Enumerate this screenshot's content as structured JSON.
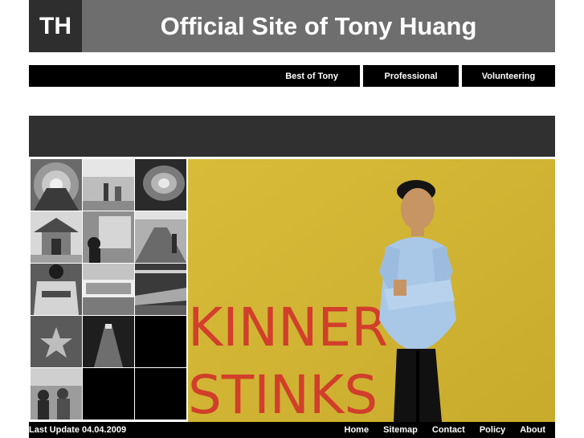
{
  "header": {
    "logo": "TH",
    "title": "Official Site of Tony Huang"
  },
  "nav": {
    "items": [
      {
        "label": "Best of Tony"
      },
      {
        "label": "Professional"
      },
      {
        "label": "Volunteering"
      }
    ]
  },
  "gallery": {
    "main_photo_graffiti": [
      "KINNER",
      "STINKS"
    ]
  },
  "footer": {
    "last_update": "Last Update 04.04.2009",
    "links": [
      {
        "label": "Home"
      },
      {
        "label": "Sitemap"
      },
      {
        "label": "Contact"
      },
      {
        "label": "Policy"
      },
      {
        "label": "About"
      }
    ]
  },
  "colors": {
    "header_bg": "#6e6e6e",
    "logo_bg": "#2e2e2e",
    "nav_bg": "#000000",
    "banner_bg": "#303030",
    "wall_yellow": "#d9bd38",
    "graffiti_red": "#d12a2a"
  }
}
